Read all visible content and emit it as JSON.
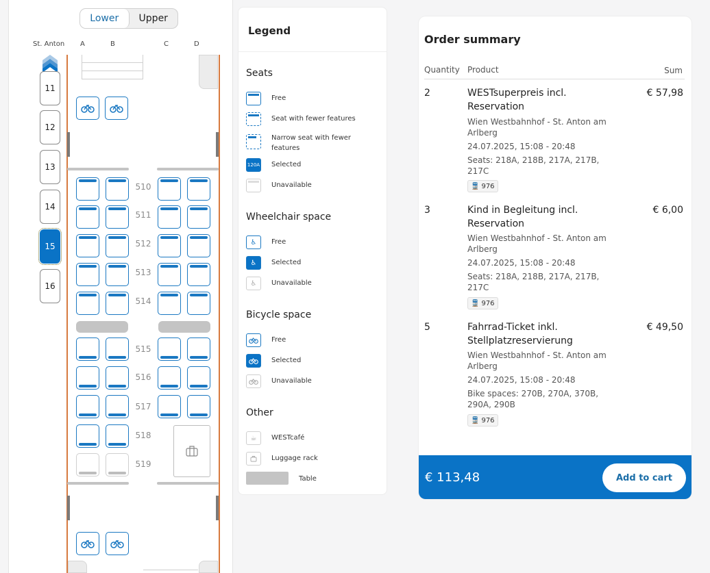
{
  "deck_toggle": {
    "lower": "Lower",
    "upper": "Upper"
  },
  "coach_header": {
    "station": "St. Anton",
    "cols": [
      "A",
      "B",
      "C",
      "D"
    ]
  },
  "cars": [
    "11",
    "12",
    "13",
    "14",
    "15",
    "16"
  ],
  "selected_car": "15",
  "rows": [
    "510",
    "511",
    "512",
    "513",
    "514",
    "515",
    "516",
    "517",
    "518",
    "519"
  ],
  "legend": {
    "title": "Legend",
    "seats": {
      "heading": "Seats",
      "free": "Free",
      "fewer": "Seat with fewer features",
      "narrow": "Narrow seat with fewer features",
      "selected": "Selected",
      "selected_tag": "120A",
      "unavailable": "Unavailable"
    },
    "wheelchair": {
      "heading": "Wheelchair space",
      "free": "Free",
      "selected": "Selected",
      "unavailable": "Unavailable"
    },
    "bicycle": {
      "heading": "Bicycle space",
      "free": "Free",
      "selected": "Selected",
      "unavailable": "Unavailable"
    },
    "other": {
      "heading": "Other",
      "cafe": "WESTcafé",
      "luggage": "Luggage rack",
      "table": "Table"
    }
  },
  "order": {
    "title": "Order summary",
    "columns": {
      "quantity": "Quantity",
      "product": "Product",
      "sum": "Sum"
    },
    "items": [
      {
        "qty": "2",
        "name": "WESTsuperpreis incl. Reservation",
        "route": "Wien Westbahnhof - St. Anton am Arlberg",
        "datetime": "24.07.2025, 15:08 - 20:48",
        "seats": "Seats: 218A, 218B, 217A, 217B, 217C",
        "train": "976",
        "sum": "€ 57,98"
      },
      {
        "qty": "3",
        "name": "Kind in Begleitung incl. Reservation",
        "route": "Wien Westbahnhof - St. Anton am Arlberg",
        "datetime": "24.07.2025, 15:08 - 20:48",
        "seats": "Seats: 218A, 218B, 217A, 217B, 217C",
        "train": "976",
        "sum": "€ 6,00"
      },
      {
        "qty": "5",
        "name": "Fahrrad-Ticket inkl. Stellplatzreservierung",
        "route": "Wien Westbahnhof - St. Anton am Arlberg",
        "datetime": "24.07.2025, 15:08 - 20:48",
        "seats": "Bike spaces: 270B, 270A, 370B, 290A, 290B",
        "train": "976",
        "sum": "€ 49,50"
      }
    ],
    "total": "€ 113,48",
    "add_to_cart": "Add to cart"
  },
  "colors": {
    "accent": "#0a73c6",
    "wall": "#d77a3f"
  }
}
